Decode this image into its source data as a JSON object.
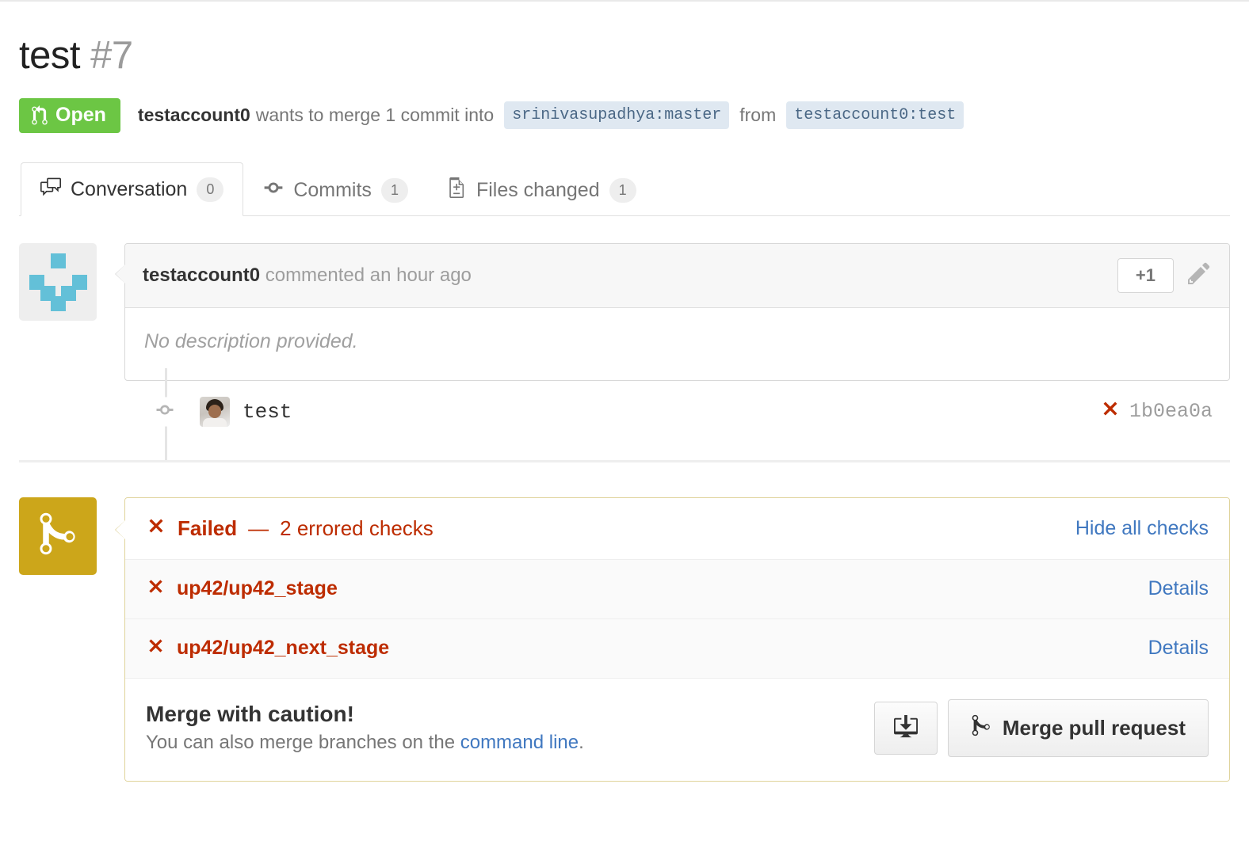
{
  "header": {
    "title": "test",
    "number": "#7",
    "state_label": "Open",
    "state_icon": "git-pull-request-icon",
    "state_color": "#6cc644",
    "author": "testaccount0",
    "merge_phrase": "wants to merge 1 commit into",
    "base_branch": "srinivasupadhya:master",
    "from_word": "from",
    "head_branch": "testaccount0:test"
  },
  "tabs": [
    {
      "label": "Conversation",
      "count": "0",
      "icon": "comment-discussion-icon",
      "active": true
    },
    {
      "label": "Commits",
      "count": "1",
      "icon": "git-commit-icon",
      "active": false
    },
    {
      "label": "Files changed",
      "count": "1",
      "icon": "diff-file-icon",
      "active": false
    }
  ],
  "comment": {
    "author": "testaccount0",
    "action": "commented an hour ago",
    "body": "No description provided.",
    "reaction_label": "+1",
    "edit_icon": "pencil-icon",
    "avatar": "identicon-avatar"
  },
  "commit": {
    "message": "test",
    "sha": "1b0ea0a",
    "status_icon": "x-icon",
    "status_color": "#bd2c00"
  },
  "merge_status": {
    "badge_icon": "git-merge-icon",
    "badge_color": "#cca61a",
    "status_word": "Failed",
    "status_dash": "—",
    "status_detail": "2 errored checks",
    "status_color": "#bd2c00",
    "toggle_label": "Hide all checks",
    "link_color": "#4078c0",
    "checks": [
      {
        "name": "up42/up42_stage",
        "icon": "x-icon",
        "details_label": "Details"
      },
      {
        "name": "up42/up42_next_stage",
        "icon": "x-icon",
        "details_label": "Details"
      }
    ],
    "merge_heading": "Merge with caution!",
    "merge_note_prefix": "You can also merge branches on the ",
    "merge_note_link": "command line",
    "merge_note_suffix": ".",
    "desktop_button_icon": "desktop-download-icon",
    "merge_button_label": "Merge pull request",
    "merge_button_icon": "git-merge-icon"
  }
}
